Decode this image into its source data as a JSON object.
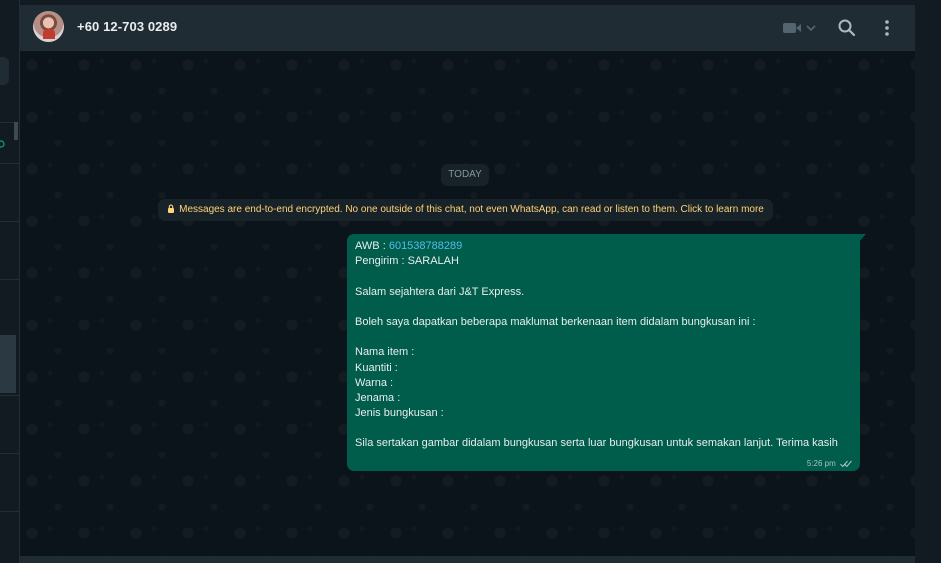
{
  "header": {
    "contact_name": "+60 12-703 0289"
  },
  "chat": {
    "date_label": "TODAY",
    "encryption_notice": "Messages are end-to-end encrypted. No one outside of this chat, not even WhatsApp, can read or listen to them. Click to learn more",
    "message": {
      "awb_label": "AWB : ",
      "awb_number": "601538788289",
      "sender_line": "Pengirim : SARALAH",
      "greeting": "Salam sejahtera dari J&T Express.",
      "request": "Boleh saya dapatkan beberapa maklumat berkenaan item didalam bungkusan ini :",
      "field_item": "Nama item :",
      "field_quantity": "Kuantiti :",
      "field_color": "Warna :",
      "field_brand": "Jenama :",
      "field_type": "Jenis bungkusan :",
      "closing": "Sila sertakan gambar didalam bungkusan serta luar bungkusan untuk semakan lanjut. Terima kasih",
      "time": "5:26 pm"
    }
  },
  "icons": {
    "video": "video-camera-icon",
    "search": "search-icon",
    "menu": "kebab-menu-icon",
    "lock": "lock-icon",
    "ticks": "double-check-icon"
  },
  "colors": {
    "header_bg": "#202c33",
    "chat_bg": "#0b141a",
    "outgoing_bubble": "#005c4b",
    "link": "#53bdeb",
    "notice_text": "#ffd279"
  }
}
